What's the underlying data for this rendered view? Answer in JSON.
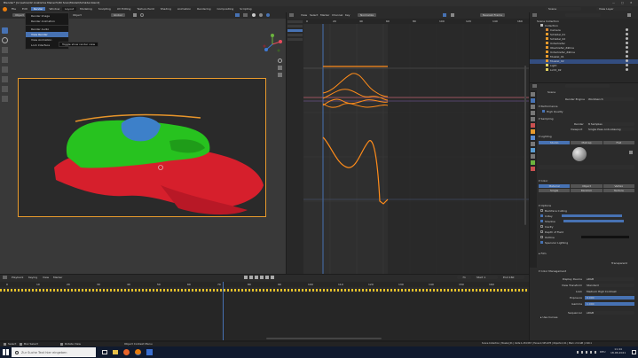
{
  "window": {
    "title": "Blender* [G:\\Lehre\\42 Anatomie Mensch\\3D Scan\\Modell\\Schädel.blend]",
    "controls": [
      "—",
      "□",
      "✕"
    ]
  },
  "topbar": {
    "menus": [
      "File",
      "Edit",
      "Render",
      "Window",
      "Help"
    ],
    "workspaces": [
      "Layout",
      "Modeling",
      "Sculpting",
      "UV Editing",
      "Texture Paint",
      "Shading",
      "Animation",
      "Rendering",
      "Compositing",
      "Scripting"
    ],
    "active_workspace": "Layout",
    "scene_label": "Scene",
    "view_layer_label": "View Layer"
  },
  "viewport": {
    "mode_label": "Object Mode",
    "header_items": [
      "View",
      "Select",
      "Add",
      "Object"
    ],
    "transform_label": "Global",
    "dropdown_items": [
      "Render Image",
      "Render Animation",
      "Render Audio",
      "View Render",
      "View Animation",
      "Lock Interface"
    ],
    "dropdown_highlight": "View Render",
    "tooltip": "Toggle show render view"
  },
  "graph_editor": {
    "header_items": [
      "View",
      "Select",
      "Marker",
      "Channel",
      "Key"
    ],
    "mode_label": "Normalize",
    "pivot_label": "Nearest Frame",
    "frame_numbers": [
      "0",
      "20",
      "40",
      "60",
      "80",
      "100",
      "120",
      "140",
      "160"
    ],
    "value_ticks": [
      "1.0",
      "0.5",
      "0.0",
      "-0.5",
      "-1.0",
      "-1.5",
      "-2.0",
      "-2.5",
      "-3.0"
    ]
  },
  "outliner": {
    "title": "Scene Collection",
    "items": [
      {
        "label": "Collection",
        "depth": 0
      },
      {
        "label": "Camera",
        "depth": 1
      },
      {
        "label": "Schädel_01",
        "depth": 1
      },
      {
        "label": "Schädel_02",
        "depth": 1
      },
      {
        "label": "Unterkiefer",
        "depth": 1
      },
      {
        "label": "Oberkiefer_Zähne",
        "depth": 1
      },
      {
        "label": "Unterkiefer_Zähne",
        "depth": 1
      },
      {
        "label": "Muskel_01",
        "depth": 1
      },
      {
        "label": "Muskel_02",
        "depth": 1
      },
      {
        "label": "Light",
        "depth": 1
      },
      {
        "label": "Licht_02",
        "depth": 1
      }
    ],
    "selected_index": 8
  },
  "properties": {
    "active_label": "Scene",
    "render_engine_label": "Render Engine",
    "render_engine_value": "Workbench",
    "sections": {
      "sampling": "Sampling",
      "performance": "Performance",
      "high_quality": "High Quality",
      "lighting": "Lighting",
      "color": "Color",
      "options": "Options",
      "film": "Film",
      "color_management": "Color Management"
    },
    "render_label": "Render",
    "render_value": "8 Samples",
    "viewport_label": "Viewport",
    "viewport_value": "Single Pass Anti-Aliasing",
    "lighting_buttons": [
      "Studio",
      "Matcap",
      "Flat"
    ],
    "lighting_active": "Studio",
    "color_buttons": [
      "Material",
      "Object",
      "Vertex",
      "Single",
      "Random",
      "Texture"
    ],
    "color_active": "Material",
    "options_rows": [
      "Backface Culling",
      "X-Ray",
      "Shadow",
      "Cavity",
      "Depth of Field",
      "Outline",
      "Specular Lighting"
    ],
    "transparent_label": "Transparent",
    "cm_rows": [
      {
        "label": "Display Device",
        "value": "sRGB"
      },
      {
        "label": "View Transform",
        "value": "Standard"
      },
      {
        "label": "Look",
        "value": "Medium High Contrast"
      },
      {
        "label": "Exposure",
        "value": "0.000"
      },
      {
        "label": "Gamma",
        "value": "1.000"
      },
      {
        "label": "Sequencer",
        "value": "sRGB"
      }
    ],
    "use_curves_label": "Use Curves"
  },
  "timeline": {
    "header_items": [
      "Playback",
      "Keying",
      "View",
      "Marker"
    ],
    "start_label": "Start",
    "start_value": "1",
    "end_label": "End",
    "end_value": "160",
    "current_frame": "71",
    "frame_numbers": [
      "0",
      "10",
      "20",
      "30",
      "40",
      "50",
      "60",
      "70",
      "80",
      "90",
      "100",
      "110",
      "120",
      "130",
      "140",
      "150",
      "160"
    ]
  },
  "statusbar": {
    "left": [
      "Select",
      "Box Select",
      "Rotate View"
    ],
    "middle": "Object Context Menu",
    "right": "Scene Collection | Muskel_01 | Verts:1,234,567 | Faces:2,345,678 | Objects:1/11 | Mem: 2.9 GiB | 2.90.1"
  },
  "taskbar": {
    "search_placeholder": "Zur Suche Text hier eingeben",
    "time": "11:44",
    "date": "18.06.2021",
    "lang": "DEU"
  },
  "colors": {
    "accent": "#4772b3",
    "curve": "#ff8c1a",
    "mesh_green": "#27c21f",
    "mesh_red": "#d61f2c"
  }
}
